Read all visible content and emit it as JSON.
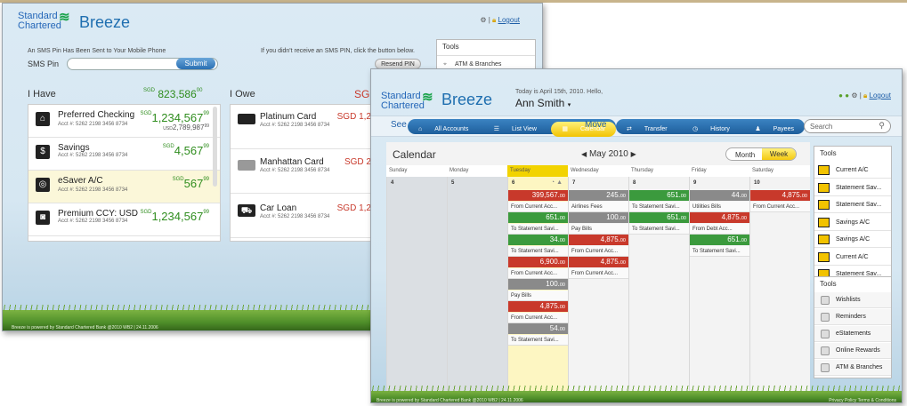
{
  "back": {
    "logo_line1": "Standard",
    "logo_line2": "Chartered",
    "app": "Breeze",
    "logout": "Logout",
    "sms_msg": "An SMS Pin Has Been Sent to Your Mobile Phone",
    "sms_label": "SMS Pin",
    "submit": "Submit",
    "resend_msg": "If you didn't receive an SMS PIN, click the button below.",
    "resend": "Resend PIN",
    "tools_title": "Tools",
    "atm": "ATM & Branches",
    "have_title": "I Have",
    "have_total_cur": "SGD",
    "have_total": "823,586",
    "have_total_dec": "00",
    "owe_title": "I Owe",
    "owe_total": "8",
    "have": [
      {
        "name": "Preferred Checking",
        "acct": "Acct #: 5262 2198 3456 8734",
        "cur": "SGD",
        "amt": "1,234,567",
        "dec": "99",
        "amt2": "2,789,987",
        "cur2": "USD",
        "dec2": "99"
      },
      {
        "name": "Savings",
        "acct": "Acct #: 5262 2198 3456 8734",
        "cur": "SGD",
        "amt": "4,567",
        "dec": "99"
      },
      {
        "name": "eSaver A/C",
        "acct": "Acct #: 5262 2198 3456 8734",
        "cur": "SGD",
        "amt": "567",
        "dec": "99"
      },
      {
        "name": "Premium CCY: USD",
        "acct": "Acct #: 5262 2198 3456 8734",
        "cur": "SGD",
        "amt": "1,234,567",
        "dec": "99"
      }
    ],
    "owe": [
      {
        "name": "Platinum Card",
        "acct": "Acct #: 5262 2198 3456 8734",
        "amt": "SGD 1,2"
      },
      {
        "name": "Manhattan Card",
        "acct": "Acct #: 5262 2198 3456 8734",
        "amt": "SGD 2"
      },
      {
        "name": "Car Loan",
        "acct": "Acct #: 5262 2198 3456 8734",
        "amt": "SGD 1,2"
      }
    ],
    "footer": "Breeze is powered by Standard Chartered Bank @2010 WB2 | 24.11.2006"
  },
  "front": {
    "logo_line1": "Standard",
    "logo_line2": "Chartered",
    "app": "Breeze",
    "greeting": "Today is April 15th, 2010. Hello,",
    "user": "Ann Smith",
    "logout": "Logout",
    "see": "See",
    "move": "Move",
    "see_tabs": [
      "All Accounts",
      "List View",
      "Calendar"
    ],
    "move_tabs": [
      "Transfer",
      "History",
      "Payees"
    ],
    "search_placeholder": "Search",
    "cal_title": "Calendar",
    "month": "May 2010",
    "view_month": "Month",
    "view_week": "Week",
    "days": [
      "Sunday",
      "Monday",
      "Tuesday",
      "Wednesday",
      "Thursday",
      "Friday",
      "Saturday"
    ],
    "dates": [
      "4",
      "5",
      "6",
      "7",
      "8",
      "9",
      "10"
    ],
    "tue": [
      {
        "t": "ev",
        "c": "r",
        "v": "399,567.",
        "d": "00"
      },
      {
        "t": "lbl",
        "v": "From Current Acc..."
      },
      {
        "t": "ev",
        "c": "g",
        "v": "651.",
        "d": "00"
      },
      {
        "t": "lbl",
        "v": "To Statement Savi..."
      },
      {
        "t": "ev",
        "c": "g",
        "v": "34.",
        "d": "00"
      },
      {
        "t": "lbl",
        "v": "To Statement Savi..."
      },
      {
        "t": "ev",
        "c": "r",
        "v": "6,900.",
        "d": "00"
      },
      {
        "t": "lbl",
        "v": "From Current Acc..."
      },
      {
        "t": "ev",
        "c": "gy",
        "v": "100.",
        "d": "00"
      },
      {
        "t": "lbl",
        "v": "Pay Bills"
      },
      {
        "t": "ev",
        "c": "r",
        "v": "4,875.",
        "d": "00"
      },
      {
        "t": "lbl",
        "v": "From Current Acc..."
      },
      {
        "t": "ev",
        "c": "gy",
        "v": "54.",
        "d": "00"
      },
      {
        "t": "lbl",
        "v": "To Statement Savi..."
      }
    ],
    "wed": [
      {
        "t": "ev",
        "c": "gy",
        "v": "245.",
        "d": "00"
      },
      {
        "t": "lbl",
        "v": "Airlines Fees"
      },
      {
        "t": "ev",
        "c": "gy",
        "v": "100.",
        "d": "00"
      },
      {
        "t": "lbl",
        "v": "Pay Bills"
      },
      {
        "t": "ev",
        "c": "r",
        "v": "4,875.",
        "d": "00"
      },
      {
        "t": "lbl",
        "v": "From Current Acc..."
      },
      {
        "t": "ev",
        "c": "r",
        "v": "4,875.",
        "d": "00"
      },
      {
        "t": "lbl",
        "v": "From Current Acc..."
      }
    ],
    "thu": [
      {
        "t": "ev",
        "c": "g",
        "v": "651.",
        "d": "00"
      },
      {
        "t": "lbl",
        "v": "To Statement Savi..."
      },
      {
        "t": "ev",
        "c": "g",
        "v": "651.",
        "d": "00"
      },
      {
        "t": "lbl",
        "v": "To Statement Savi..."
      }
    ],
    "fri": [
      {
        "t": "ev",
        "c": "gy",
        "v": "44.",
        "d": "00"
      },
      {
        "t": "lbl",
        "v": "Utilities Bills"
      },
      {
        "t": "ev",
        "c": "r",
        "v": "4,875.",
        "d": "00"
      },
      {
        "t": "lbl",
        "v": "From Debt Acc..."
      },
      {
        "t": "ev",
        "c": "g",
        "v": "651.",
        "d": "00"
      },
      {
        "t": "lbl",
        "v": "To Statement Savi..."
      }
    ],
    "sat": [
      {
        "t": "ev",
        "c": "r",
        "v": "4,875.",
        "d": "00"
      },
      {
        "t": "lbl",
        "v": "From Current Acc..."
      }
    ],
    "tools_title": "Tools",
    "tools": [
      "Current A/C",
      "Statement Sav...",
      "Statement Sav...",
      "Savings A/C",
      "Savings A/C",
      "Current A/C",
      "Statement Sav..."
    ],
    "tools2_title": "Tools",
    "tools2": [
      "Wishlists",
      "Reminders",
      "eStatements",
      "Online Rewards",
      "ATM & Branches"
    ],
    "footer": "Breeze is powered by Standard Chartered Bank @2010 WB2 | 24.11.2006",
    "footer_right": "Privacy Policy  Terms & Conditions"
  }
}
